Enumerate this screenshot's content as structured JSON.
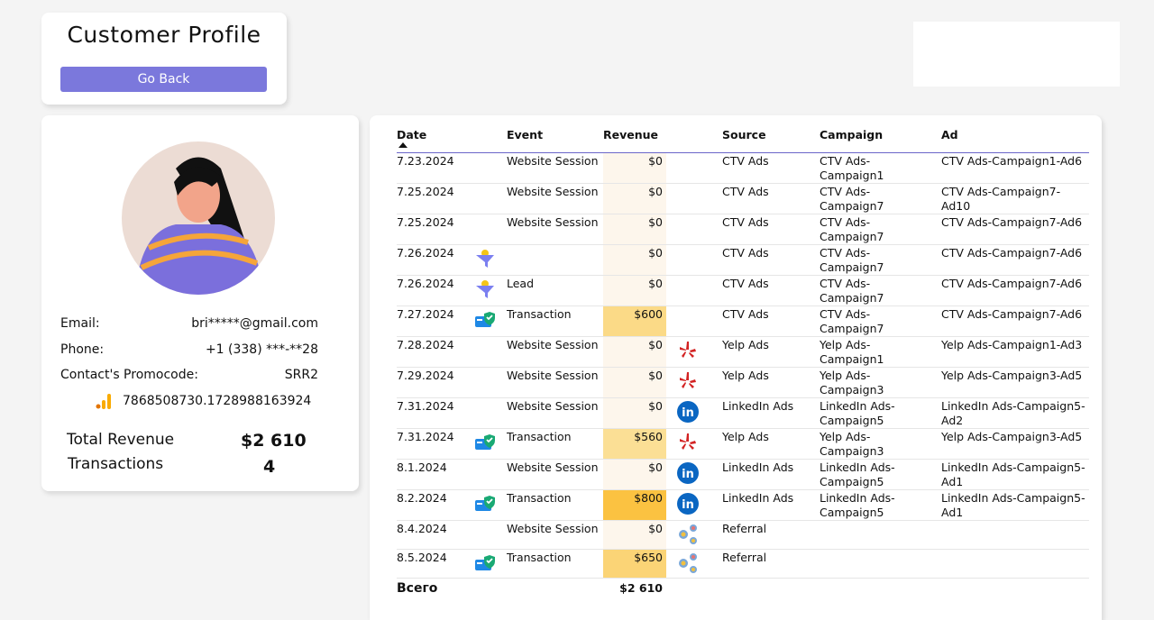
{
  "header": {
    "title": "Customer Profile",
    "back_label": "Go Back"
  },
  "profile": {
    "email_label": "Email:",
    "email": "bri*****@gmail.com",
    "phone_label": "Phone:",
    "phone": "+1 (338) ***-**28",
    "promo_label": "Contact's Promocode:",
    "promo": "SRR2",
    "ga_id": "7868508730.1728988163924",
    "total_revenue_label": "Total Revenue",
    "total_revenue": "$2 610",
    "transactions_label": "Transactions",
    "transactions": "4"
  },
  "table": {
    "columns": [
      "Date",
      "Event",
      "Revenue",
      "Source",
      "Campaign",
      "Ad"
    ],
    "rows": [
      {
        "date": "7.23.2024",
        "event_icon": "",
        "event": "Website Session",
        "revenue": "$0",
        "rev": 0,
        "source_icon": "",
        "source": "CTV Ads",
        "campaign": "CTV Ads-Campaign1",
        "ad": "CTV Ads-Campaign1-Ad6"
      },
      {
        "date": "7.25.2024",
        "event_icon": "",
        "event": "Website Session",
        "revenue": "$0",
        "rev": 0,
        "source_icon": "",
        "source": "CTV Ads",
        "campaign": "CTV Ads-Campaign7",
        "ad": "CTV Ads-Campaign7-Ad10"
      },
      {
        "date": "7.25.2024",
        "event_icon": "",
        "event": "Website Session",
        "revenue": "$0",
        "rev": 0,
        "source_icon": "",
        "source": "CTV Ads",
        "campaign": "CTV Ads-Campaign7",
        "ad": "CTV Ads-Campaign7-Ad6"
      },
      {
        "date": "7.26.2024",
        "event_icon": "funnel",
        "event": "",
        "revenue": "$0",
        "rev": 0,
        "source_icon": "",
        "source": "CTV Ads",
        "campaign": "CTV Ads-Campaign7",
        "ad": "CTV Ads-Campaign7-Ad6"
      },
      {
        "date": "7.26.2024",
        "event_icon": "funnel",
        "event": "Lead",
        "revenue": "$0",
        "rev": 0,
        "source_icon": "",
        "source": "CTV Ads",
        "campaign": "CTV Ads-Campaign7",
        "ad": "CTV Ads-Campaign7-Ad6"
      },
      {
        "date": "7.27.2024",
        "event_icon": "payment",
        "event": "Transaction",
        "revenue": "$600",
        "rev": 600,
        "source_icon": "",
        "source": "CTV Ads",
        "campaign": "CTV Ads-Campaign7",
        "ad": "CTV Ads-Campaign7-Ad6"
      },
      {
        "date": "7.28.2024",
        "event_icon": "",
        "event": "Website Session",
        "revenue": "$0",
        "rev": 0,
        "source_icon": "yelp",
        "source": "Yelp Ads",
        "campaign": "Yelp Ads-Campaign1",
        "ad": "Yelp Ads-Campaign1-Ad3"
      },
      {
        "date": "7.29.2024",
        "event_icon": "",
        "event": "Website Session",
        "revenue": "$0",
        "rev": 0,
        "source_icon": "yelp",
        "source": "Yelp Ads",
        "campaign": "Yelp Ads-Campaign3",
        "ad": "Yelp Ads-Campaign3-Ad5"
      },
      {
        "date": "7.31.2024",
        "event_icon": "",
        "event": "Website Session",
        "revenue": "$0",
        "rev": 0,
        "source_icon": "linkedin",
        "source": "LinkedIn Ads",
        "campaign": "LinkedIn Ads-Campaign5",
        "ad": "LinkedIn Ads-Campaign5-Ad2"
      },
      {
        "date": "7.31.2024",
        "event_icon": "payment",
        "event": "Transaction",
        "revenue": "$560",
        "rev": 560,
        "source_icon": "yelp",
        "source": "Yelp Ads",
        "campaign": "Yelp Ads-Campaign3",
        "ad": "Yelp Ads-Campaign3-Ad5"
      },
      {
        "date": "8.1.2024",
        "event_icon": "",
        "event": "Website Session",
        "revenue": "$0",
        "rev": 0,
        "source_icon": "linkedin",
        "source": "LinkedIn Ads",
        "campaign": "LinkedIn Ads-Campaign5",
        "ad": "LinkedIn Ads-Campaign5-Ad1"
      },
      {
        "date": "8.2.2024",
        "event_icon": "payment",
        "event": "Transaction",
        "revenue": "$800",
        "rev": 800,
        "source_icon": "linkedin",
        "source": "LinkedIn Ads",
        "campaign": "LinkedIn Ads-Campaign5",
        "ad": "LinkedIn Ads-Campaign5-Ad1"
      },
      {
        "date": "8.4.2024",
        "event_icon": "",
        "event": "Website Session",
        "revenue": "$0",
        "rev": 0,
        "source_icon": "referral",
        "source": "Referral",
        "campaign": "",
        "ad": ""
      },
      {
        "date": "8.5.2024",
        "event_icon": "payment",
        "event": "Transaction",
        "revenue": "$650",
        "rev": 650,
        "source_icon": "referral",
        "source": "Referral",
        "campaign": "",
        "ad": ""
      }
    ],
    "total_label": "Всего",
    "total": "$2 610"
  }
}
